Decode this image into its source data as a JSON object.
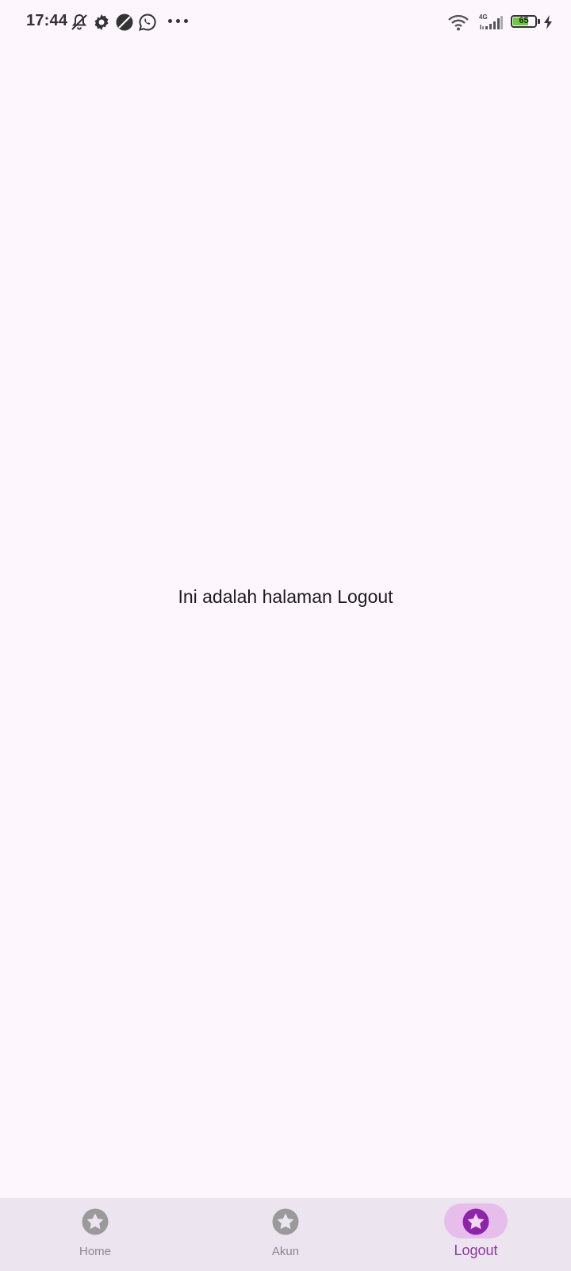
{
  "status_bar": {
    "time": "17:44",
    "icons": [
      "bell-off-icon",
      "gear-icon",
      "circle-slash-icon",
      "whatsapp-icon",
      "more-icon",
      "wifi-icon",
      "signal-icon",
      "battery-icon",
      "charging-icon"
    ],
    "network": "4G",
    "battery_level": "65"
  },
  "main": {
    "message": "Ini adalah halaman Logout"
  },
  "bottom_nav": {
    "items": [
      {
        "label": "Home",
        "icon": "star-icon",
        "active": false
      },
      {
        "label": "Akun",
        "icon": "star-icon",
        "active": false
      },
      {
        "label": "Logout",
        "icon": "star-icon",
        "active": true
      }
    ]
  },
  "colors": {
    "background": "#fdf7fd",
    "nav_background": "#ece4ef",
    "active_pill": "#e7bdec",
    "active_color": "#8e3aa0",
    "inactive_color": "#8a8a8a"
  }
}
